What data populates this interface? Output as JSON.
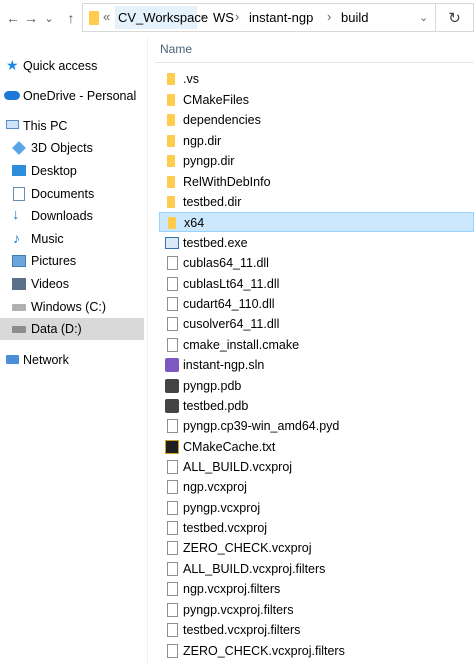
{
  "toolbar": {
    "back": "←",
    "forward": "→",
    "dropdown": "⌄",
    "up": "↑",
    "overflow": "«",
    "crumbs": [
      "CV_Workspace",
      "WS",
      "instant-ngp",
      "build"
    ],
    "sep": "›",
    "refresh": "↻"
  },
  "nav": {
    "items": [
      {
        "label": "Quick access",
        "icon": "star-icon"
      },
      {
        "label": "OneDrive - Personal",
        "icon": "cloud-icon"
      },
      {
        "label": "This PC",
        "icon": "computer-icon"
      },
      {
        "label": "3D Objects",
        "icon": "cube-icon"
      },
      {
        "label": "Desktop",
        "icon": "desktop-icon"
      },
      {
        "label": "Documents",
        "icon": "documents-icon"
      },
      {
        "label": "Downloads",
        "icon": "download-icon"
      },
      {
        "label": "Music",
        "icon": "music-icon"
      },
      {
        "label": "Pictures",
        "icon": "pictures-icon"
      },
      {
        "label": "Videos",
        "icon": "videos-icon"
      },
      {
        "label": "Windows (C:)",
        "icon": "drive-c-icon"
      },
      {
        "label": "Data (D:)",
        "icon": "drive-d-icon"
      },
      {
        "label": "Network",
        "icon": "network-icon"
      }
    ]
  },
  "list": {
    "column_name": "Name",
    "files": [
      {
        "name": ".vs",
        "icon": "folder-icon"
      },
      {
        "name": "CMakeFiles",
        "icon": "folder-icon"
      },
      {
        "name": "dependencies",
        "icon": "folder-icon"
      },
      {
        "name": "ngp.dir",
        "icon": "folder-icon"
      },
      {
        "name": "pyngp.dir",
        "icon": "folder-icon"
      },
      {
        "name": "RelWithDebInfo",
        "icon": "folder-icon"
      },
      {
        "name": "testbed.dir",
        "icon": "folder-icon"
      },
      {
        "name": "x64",
        "icon": "folder-icon"
      },
      {
        "name": "testbed.exe",
        "icon": "exe-icon"
      },
      {
        "name": "cublas64_11.dll",
        "icon": "dll-icon"
      },
      {
        "name": "cublasLt64_11.dll",
        "icon": "dll-icon"
      },
      {
        "name": "cudart64_110.dll",
        "icon": "dll-icon"
      },
      {
        "name": "cusolver64_11.dll",
        "icon": "dll-icon"
      },
      {
        "name": "cmake_install.cmake",
        "icon": "file-icon"
      },
      {
        "name": "instant-ngp.sln",
        "icon": "sln-icon"
      },
      {
        "name": "pyngp.pdb",
        "icon": "pdb-icon"
      },
      {
        "name": "testbed.pdb",
        "icon": "pdb-icon"
      },
      {
        "name": "pyngp.cp39-win_amd64.pyd",
        "icon": "file-icon"
      },
      {
        "name": "CMakeCache.txt",
        "icon": "text-icon"
      },
      {
        "name": "ALL_BUILD.vcxproj",
        "icon": "vcxproj-icon"
      },
      {
        "name": "ngp.vcxproj",
        "icon": "vcxproj-icon"
      },
      {
        "name": "pyngp.vcxproj",
        "icon": "vcxproj-icon"
      },
      {
        "name": "testbed.vcxproj",
        "icon": "vcxproj-icon"
      },
      {
        "name": "ZERO_CHECK.vcxproj",
        "icon": "vcxproj-icon"
      },
      {
        "name": "ALL_BUILD.vcxproj.filters",
        "icon": "filters-icon"
      },
      {
        "name": "ngp.vcxproj.filters",
        "icon": "filters-icon"
      },
      {
        "name": "pyngp.vcxproj.filters",
        "icon": "filters-icon"
      },
      {
        "name": "testbed.vcxproj.filters",
        "icon": "filters-icon"
      },
      {
        "name": "ZERO_CHECK.vcxproj.filters",
        "icon": "filters-icon"
      }
    ]
  },
  "colors": {
    "folder": "#ffcc4d",
    "selection": "#cce8ff",
    "selection_border": "#99d1ff",
    "nav_selected": "#d9d9d9",
    "header_text": "#4c607a"
  }
}
